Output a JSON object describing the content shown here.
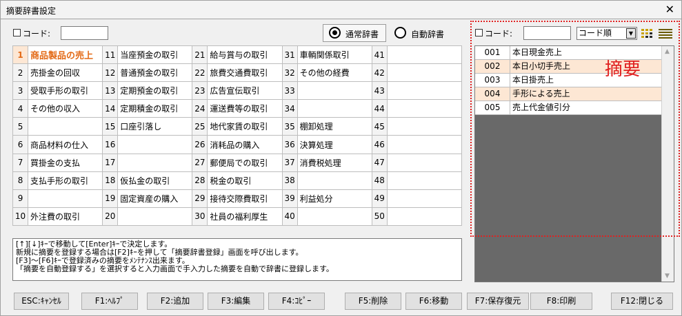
{
  "window": {
    "title": "摘要辞書設定",
    "close": "✕"
  },
  "left_code": {
    "label": "コード:",
    "value": ""
  },
  "radio": [
    {
      "label": "通常辞書",
      "selected": true
    },
    {
      "label": "自動辞書",
      "selected": false
    }
  ],
  "grid": [
    [
      {
        "n": "1",
        "t": "商品製品の売上"
      },
      {
        "n": "11",
        "t": "当座預金の取引"
      },
      {
        "n": "21",
        "t": "給与賞与の取引"
      },
      {
        "n": "31",
        "t": "車輌関係取引"
      },
      {
        "n": "41",
        "t": ""
      }
    ],
    [
      {
        "n": "2",
        "t": "売掛金の回収"
      },
      {
        "n": "12",
        "t": "普通預金の取引"
      },
      {
        "n": "22",
        "t": "旅費交通費取引"
      },
      {
        "n": "32",
        "t": "その他の経費"
      },
      {
        "n": "42",
        "t": ""
      }
    ],
    [
      {
        "n": "3",
        "t": "受取手形の取引"
      },
      {
        "n": "13",
        "t": "定期預金の取引"
      },
      {
        "n": "23",
        "t": "広告宣伝取引"
      },
      {
        "n": "33",
        "t": ""
      },
      {
        "n": "43",
        "t": ""
      }
    ],
    [
      {
        "n": "4",
        "t": "その他の収入"
      },
      {
        "n": "14",
        "t": "定期積金の取引"
      },
      {
        "n": "24",
        "t": "運送費等の取引"
      },
      {
        "n": "34",
        "t": ""
      },
      {
        "n": "44",
        "t": ""
      }
    ],
    [
      {
        "n": "5",
        "t": ""
      },
      {
        "n": "15",
        "t": "口座引落し"
      },
      {
        "n": "25",
        "t": "地代家賃の取引"
      },
      {
        "n": "35",
        "t": "棚卸処理"
      },
      {
        "n": "45",
        "t": ""
      }
    ],
    [
      {
        "n": "6",
        "t": "商品材料の仕入"
      },
      {
        "n": "16",
        "t": ""
      },
      {
        "n": "26",
        "t": "消耗品の購入"
      },
      {
        "n": "36",
        "t": "決算処理"
      },
      {
        "n": "46",
        "t": ""
      }
    ],
    [
      {
        "n": "7",
        "t": "買掛金の支払"
      },
      {
        "n": "17",
        "t": ""
      },
      {
        "n": "27",
        "t": "郵便局での取引"
      },
      {
        "n": "37",
        "t": "消費税処理"
      },
      {
        "n": "47",
        "t": ""
      }
    ],
    [
      {
        "n": "8",
        "t": "支払手形の取引"
      },
      {
        "n": "18",
        "t": "仮払金の取引"
      },
      {
        "n": "28",
        "t": "税金の取引"
      },
      {
        "n": "38",
        "t": ""
      },
      {
        "n": "48",
        "t": ""
      }
    ],
    [
      {
        "n": "9",
        "t": ""
      },
      {
        "n": "19",
        "t": "固定資産の購入"
      },
      {
        "n": "29",
        "t": "接待交際費取引"
      },
      {
        "n": "39",
        "t": "利益処分"
      },
      {
        "n": "49",
        "t": ""
      }
    ],
    [
      {
        "n": "10",
        "t": "外注費の取引"
      },
      {
        "n": "20",
        "t": ""
      },
      {
        "n": "30",
        "t": "社員の福利厚生"
      },
      {
        "n": "40",
        "t": ""
      },
      {
        "n": "50",
        "t": ""
      }
    ]
  ],
  "help": [
    "[↑][↓]ｷｰで移動して[Enter]ｷｰで決定します。",
    "新規に摘要を登録する場合は[F2]ｷｰを押して「摘要辞書登録」画面を呼び出します。",
    "[F3]～[F6]ｷｰで登録済みの摘要をﾒﾝﾃﾅﾝｽ出来ます。",
    "「摘要を自動登録する」を選択すると入力画面で手入力した摘要を自動で辞書に登録します。"
  ],
  "right_code": {
    "label": "コード:",
    "value": "",
    "sort": "コード順"
  },
  "right_list": [
    {
      "code": "001",
      "desc": "本日現金売上"
    },
    {
      "code": "002",
      "desc": "本日小切手売上"
    },
    {
      "code": "003",
      "desc": "本日掛売上"
    },
    {
      "code": "004",
      "desc": "手形による売上"
    },
    {
      "code": "005",
      "desc": "売上代金値引分"
    }
  ],
  "annotation": "摘要",
  "buttons": [
    "ESC:ｷｬﾝｾﾙ",
    "F1:ﾍﾙﾌﾟ",
    "F2:追加",
    "F3:編集",
    "F4:ｺﾋﾟｰ",
    "F5:削除",
    "F6:移動",
    "F7:保存復元",
    "F8:印刷",
    "F12:閉じる"
  ],
  "colors": {
    "accent": "#e36a16",
    "annotation": "#e02020",
    "selected_bg": "#fde7d4"
  }
}
